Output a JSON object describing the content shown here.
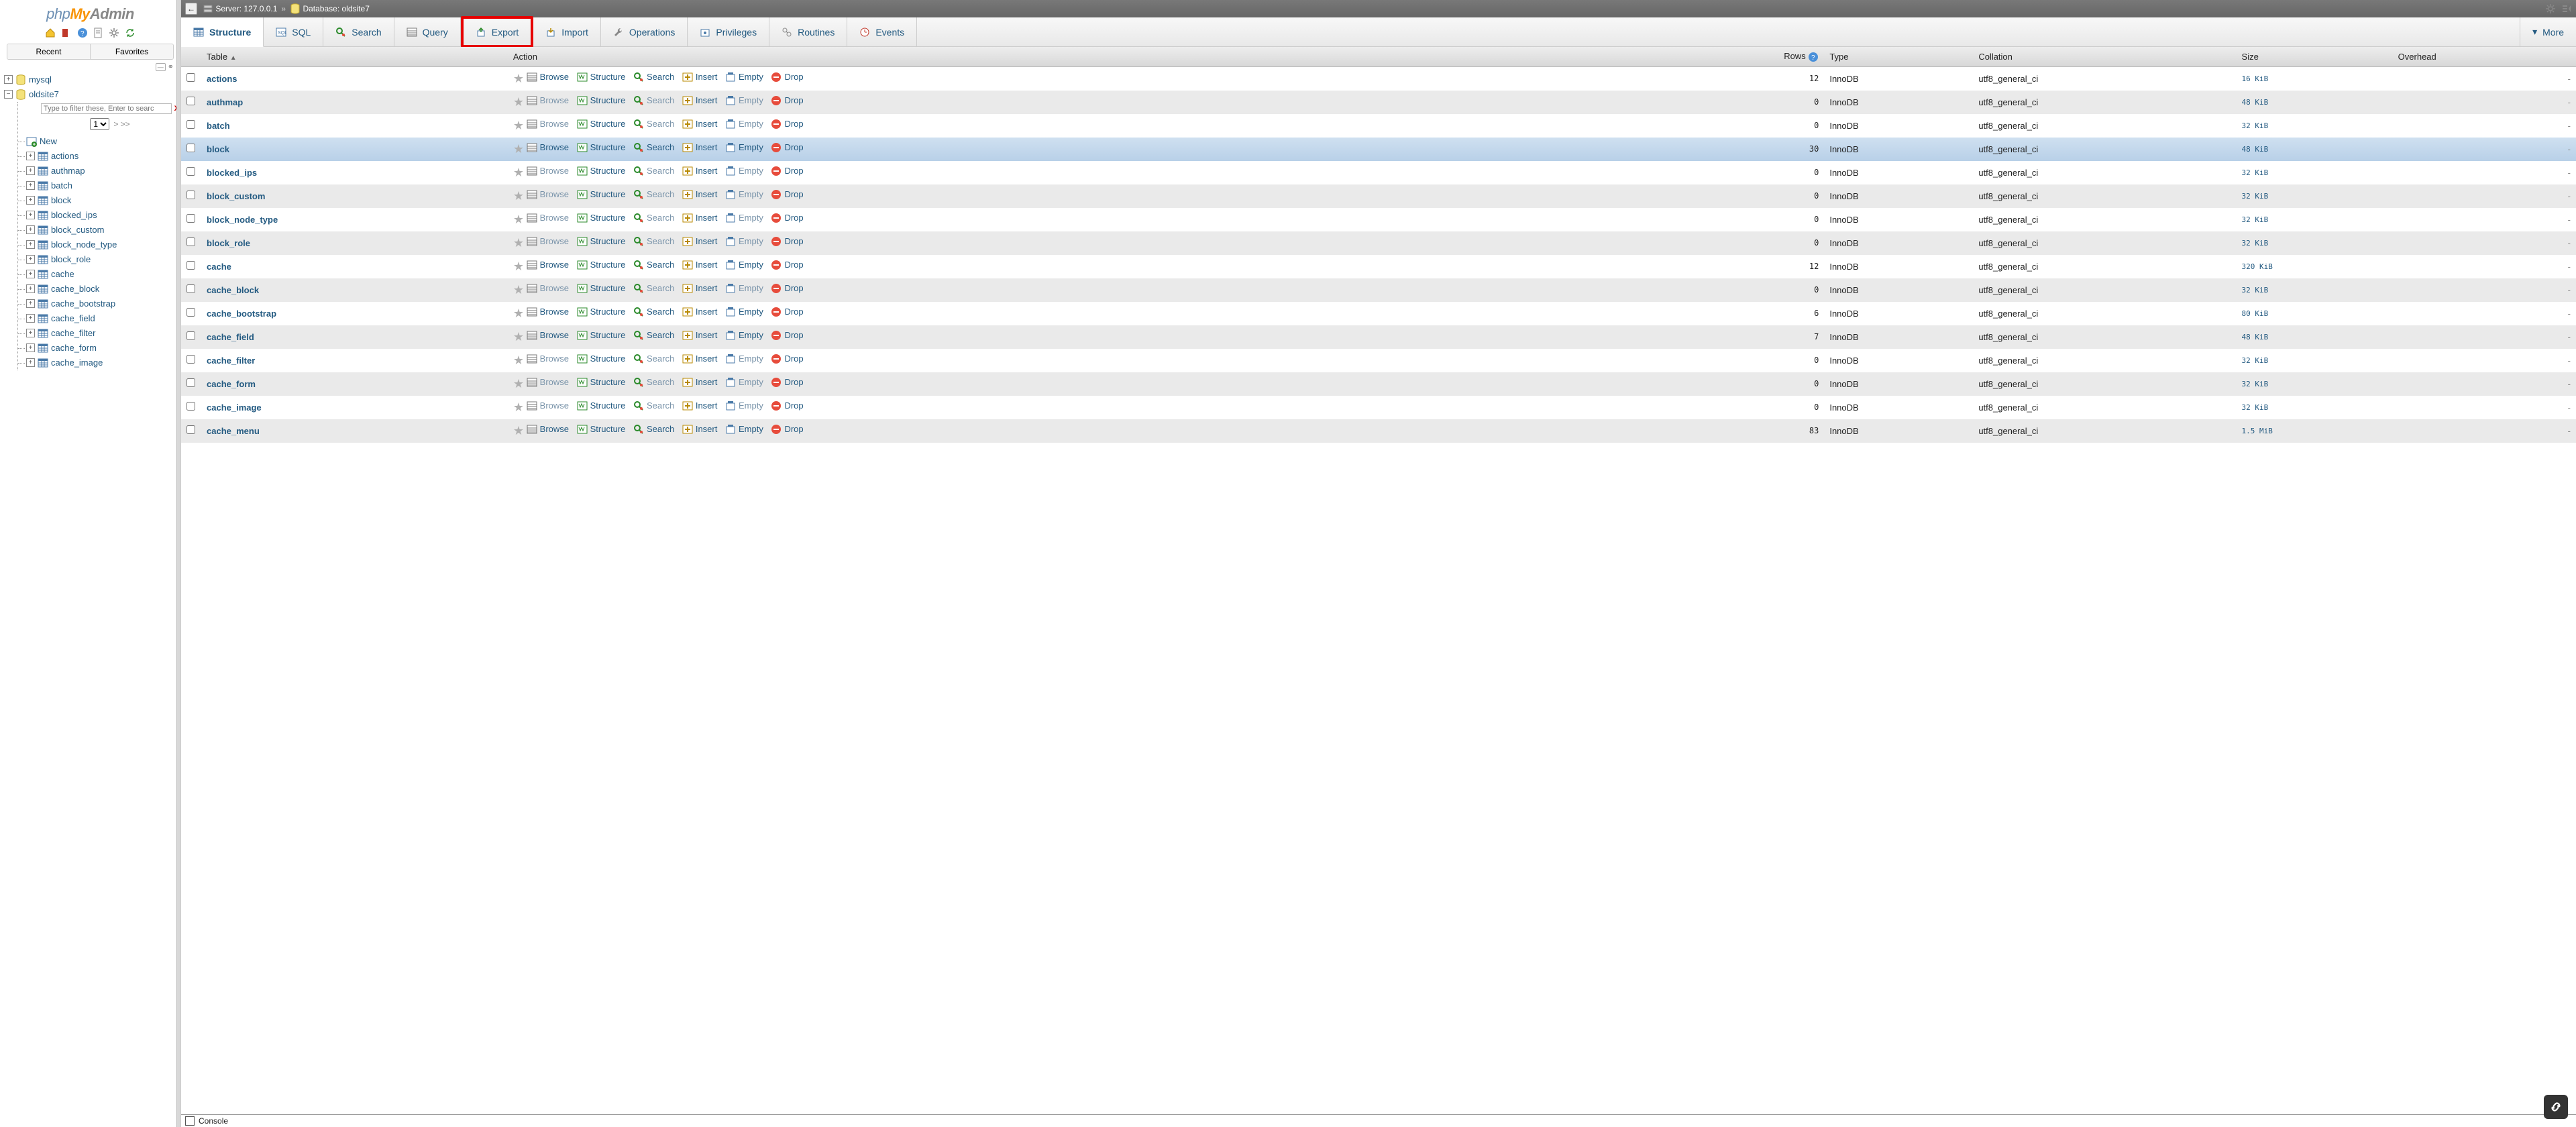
{
  "logo": {
    "a": "php",
    "b": "My",
    "c": "Admin"
  },
  "sidebar_buttons": {
    "recent": "Recent",
    "favorites": "Favorites"
  },
  "tree": {
    "top_dbs": [
      {
        "name": "mysql",
        "expanded": false
      }
    ],
    "active_db": "oldsite7",
    "filter_placeholder": "Type to filter these, Enter to searc",
    "pager_value": "1",
    "pager_suffix": "> >>",
    "new_label": "New",
    "tables": [
      "actions",
      "authmap",
      "batch",
      "block",
      "blocked_ips",
      "block_custom",
      "block_node_type",
      "block_role",
      "cache",
      "cache_block",
      "cache_bootstrap",
      "cache_field",
      "cache_filter",
      "cache_form",
      "cache_image"
    ]
  },
  "breadcrumb": {
    "server_label": "Server:",
    "server_value": "127.0.0.1",
    "db_label": "Database:",
    "db_value": "oldsite7"
  },
  "tabs": [
    {
      "label": "Structure",
      "active": true
    },
    {
      "label": "SQL"
    },
    {
      "label": "Search"
    },
    {
      "label": "Query"
    },
    {
      "label": "Export",
      "highlight": true
    },
    {
      "label": "Import"
    },
    {
      "label": "Operations"
    },
    {
      "label": "Privileges"
    },
    {
      "label": "Routines"
    },
    {
      "label": "Events"
    }
  ],
  "tabs_more": "More",
  "columns": {
    "table": "Table",
    "action": "Action",
    "rows": "Rows",
    "type": "Type",
    "collation": "Collation",
    "size": "Size",
    "overhead": "Overhead"
  },
  "actions": {
    "browse": "Browse",
    "structure": "Structure",
    "search": "Search",
    "insert": "Insert",
    "empty": "Empty",
    "drop": "Drop"
  },
  "rows": [
    {
      "name": "actions",
      "rows": "12",
      "type": "InnoDB",
      "collation": "utf8_general_ci",
      "size": "16 KiB",
      "overhead": "-",
      "muted": false
    },
    {
      "name": "authmap",
      "rows": "0",
      "type": "InnoDB",
      "collation": "utf8_general_ci",
      "size": "48 KiB",
      "overhead": "-",
      "muted": true
    },
    {
      "name": "batch",
      "rows": "0",
      "type": "InnoDB",
      "collation": "utf8_general_ci",
      "size": "32 KiB",
      "overhead": "-",
      "muted": true
    },
    {
      "name": "block",
      "rows": "30",
      "type": "InnoDB",
      "collation": "utf8_general_ci",
      "size": "48 KiB",
      "overhead": "-",
      "muted": false,
      "hover": true
    },
    {
      "name": "blocked_ips",
      "rows": "0",
      "type": "InnoDB",
      "collation": "utf8_general_ci",
      "size": "32 KiB",
      "overhead": "-",
      "muted": true
    },
    {
      "name": "block_custom",
      "rows": "0",
      "type": "InnoDB",
      "collation": "utf8_general_ci",
      "size": "32 KiB",
      "overhead": "-",
      "muted": true
    },
    {
      "name": "block_node_type",
      "rows": "0",
      "type": "InnoDB",
      "collation": "utf8_general_ci",
      "size": "32 KiB",
      "overhead": "-",
      "muted": true
    },
    {
      "name": "block_role",
      "rows": "0",
      "type": "InnoDB",
      "collation": "utf8_general_ci",
      "size": "32 KiB",
      "overhead": "-",
      "muted": true
    },
    {
      "name": "cache",
      "rows": "12",
      "type": "InnoDB",
      "collation": "utf8_general_ci",
      "size": "320 KiB",
      "overhead": "-",
      "muted": false
    },
    {
      "name": "cache_block",
      "rows": "0",
      "type": "InnoDB",
      "collation": "utf8_general_ci",
      "size": "32 KiB",
      "overhead": "-",
      "muted": true
    },
    {
      "name": "cache_bootstrap",
      "rows": "6",
      "type": "InnoDB",
      "collation": "utf8_general_ci",
      "size": "80 KiB",
      "overhead": "-",
      "muted": false
    },
    {
      "name": "cache_field",
      "rows": "7",
      "type": "InnoDB",
      "collation": "utf8_general_ci",
      "size": "48 KiB",
      "overhead": "-",
      "muted": false
    },
    {
      "name": "cache_filter",
      "rows": "0",
      "type": "InnoDB",
      "collation": "utf8_general_ci",
      "size": "32 KiB",
      "overhead": "-",
      "muted": true
    },
    {
      "name": "cache_form",
      "rows": "0",
      "type": "InnoDB",
      "collation": "utf8_general_ci",
      "size": "32 KiB",
      "overhead": "-",
      "muted": true
    },
    {
      "name": "cache_image",
      "rows": "0",
      "type": "InnoDB",
      "collation": "utf8_general_ci",
      "size": "32 KiB",
      "overhead": "-",
      "muted": true
    },
    {
      "name": "cache_menu",
      "rows": "83",
      "type": "InnoDB",
      "collation": "utf8_general_ci",
      "size": "1.5 MiB",
      "overhead": "-",
      "muted": false
    }
  ],
  "console_label": "Console"
}
